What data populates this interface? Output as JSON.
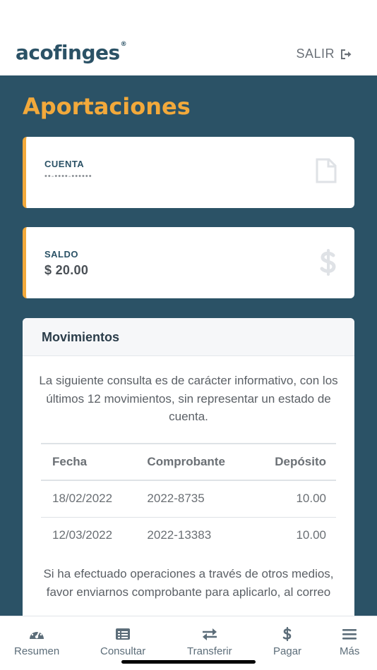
{
  "header": {
    "logo_text": "acofinges",
    "logo_mark": "®",
    "logout_label": "SALIR"
  },
  "page_title": "Aportaciones",
  "account_card": {
    "label": "CUENTA",
    "value": "••-••••-••••••"
  },
  "balance_card": {
    "label": "SALDO",
    "value": "$ 20.00"
  },
  "movements": {
    "title": "Movimientos",
    "notice": "La siguiente consulta es de carácter informativo, con los últimos 12 movimientos, sin representar un estado de cuenta.",
    "columns": [
      "Fecha",
      "Comprobante",
      "Depósito"
    ],
    "rows": [
      [
        "18/02/2022",
        "2022-8735",
        "10.00"
      ],
      [
        "12/03/2022",
        "2022-13383",
        "10.00"
      ]
    ],
    "footer_note": "Si ha efectuado operaciones a través de otros medios, favor enviarnos comprobante para aplicarlo, al correo"
  },
  "bottom_nav": {
    "items": [
      {
        "label": "Resumen",
        "icon": "speedometer-icon"
      },
      {
        "label": "Consultar",
        "icon": "list-icon"
      },
      {
        "label": "Transferir",
        "icon": "exchange-icon"
      },
      {
        "label": "Pagar",
        "icon": "dollar-icon"
      },
      {
        "label": "Más",
        "icon": "menu-icon"
      }
    ]
  },
  "colors": {
    "primary": "#2b5266",
    "accent": "#f2a93b"
  }
}
